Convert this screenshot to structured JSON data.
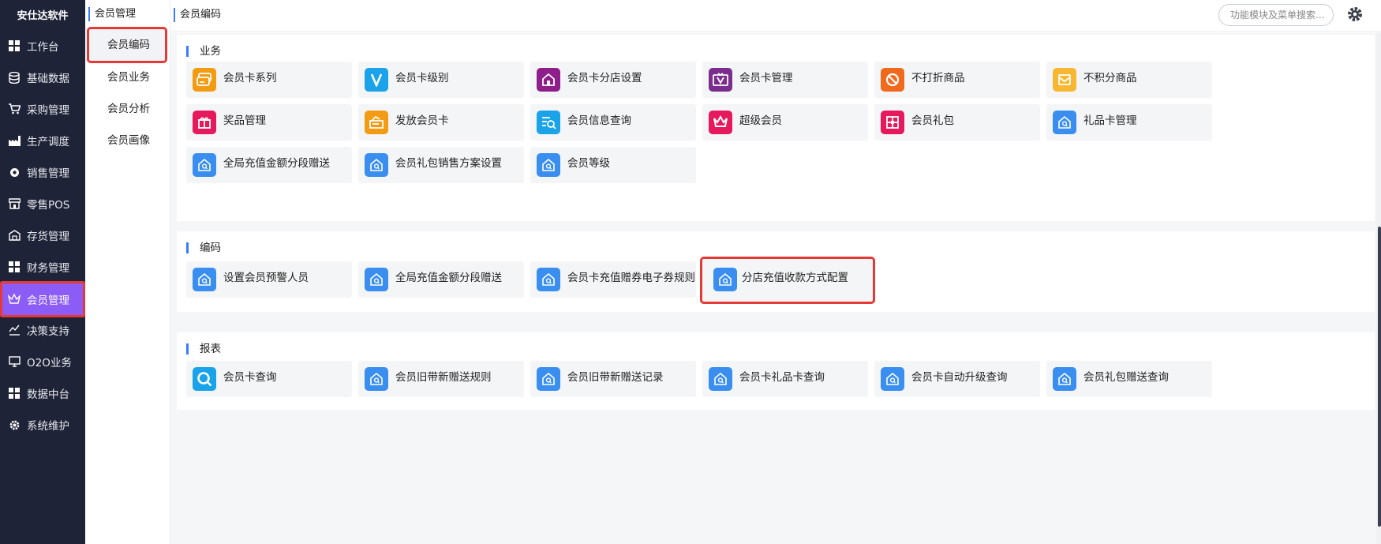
{
  "app": {
    "brand": "安仕达软件"
  },
  "sidebar": {
    "items": [
      {
        "label": "工作台",
        "icon": "grid-icon"
      },
      {
        "label": "基础数据",
        "icon": "database-icon"
      },
      {
        "label": "采购管理",
        "icon": "cart-icon"
      },
      {
        "label": "生产调度",
        "icon": "factory-icon"
      },
      {
        "label": "销售管理",
        "icon": "gear-sales-icon"
      },
      {
        "label": "零售POS",
        "icon": "store-icon"
      },
      {
        "label": "存货管理",
        "icon": "warehouse-icon"
      },
      {
        "label": "财务管理",
        "icon": "grid-icon"
      },
      {
        "label": "会员管理",
        "icon": "crown-icon",
        "active": true
      },
      {
        "label": "决策支持",
        "icon": "chart-icon"
      },
      {
        "label": "O2O业务",
        "icon": "monitor-icon"
      },
      {
        "label": "数据中台",
        "icon": "grid-icon"
      },
      {
        "label": "系统维护",
        "icon": "gear-icon"
      }
    ]
  },
  "submenu": {
    "title": "会员管理",
    "items": [
      "会员编码",
      "会员业务",
      "会员分析",
      "会员画像"
    ],
    "active": "会员编码"
  },
  "topbar": {
    "breadcrumb": "会员编码",
    "search_placeholder": "功能模块及菜单搜索..."
  },
  "sections": {
    "business": {
      "title": "业务",
      "tiles": [
        {
          "label": "会员卡系列",
          "icon": "card-series-icon",
          "color": "#f29b13"
        },
        {
          "label": "会员卡级别",
          "icon": "v-level-icon",
          "color": "#1aa3e8"
        },
        {
          "label": "会员卡分店设置",
          "icon": "store-house-icon",
          "color": "#8e1f8a"
        },
        {
          "label": "会员卡管理",
          "icon": "v-card-icon",
          "color": "#7b2d8e"
        },
        {
          "label": "不打折商品",
          "icon": "no-discount-icon",
          "color": "#f06a1d"
        },
        {
          "label": "不积分商品",
          "icon": "mail-box-icon",
          "color": "#f7b733"
        },
        {
          "label": "奖品管理",
          "icon": "gift-icon",
          "color": "#e6195d"
        },
        {
          "label": "发放会员卡",
          "icon": "issue-card-icon",
          "color": "#f29b13"
        },
        {
          "label": "会员信息查询",
          "icon": "info-search-icon",
          "color": "#1aa3e8"
        },
        {
          "label": "超级会员",
          "icon": "crown-icon",
          "color": "#e6195d"
        },
        {
          "label": "会员礼包",
          "icon": "gift-pack-icon",
          "color": "#e6195d"
        },
        {
          "label": "礼品卡管理",
          "icon": "home-search-icon",
          "color": "#3a8ef0"
        },
        {
          "label": "全局充值金额分段赠送",
          "icon": "home-search-icon",
          "color": "#3a8ef0"
        },
        {
          "label": "会员礼包销售方案设置",
          "icon": "home-search-icon",
          "color": "#3a8ef0"
        },
        {
          "label": "会员等级",
          "icon": "home-search-icon",
          "color": "#3a8ef0"
        }
      ]
    },
    "coding": {
      "title": "编码",
      "tiles": [
        {
          "label": "设置会员预警人员",
          "icon": "home-search-icon",
          "color": "#3a8ef0"
        },
        {
          "label": "全局充值金额分段赠送",
          "icon": "home-search-icon",
          "color": "#3a8ef0"
        },
        {
          "label": "会员卡充值赠券电子券规则",
          "icon": "home-search-icon",
          "color": "#3a8ef0"
        },
        {
          "label": "分店充值收款方式配置",
          "icon": "home-search-icon",
          "color": "#3a8ef0",
          "highlight": true
        }
      ]
    },
    "reports": {
      "title": "报表",
      "tiles": [
        {
          "label": "会员卡查询",
          "icon": "magnifier-icon",
          "color": "#1aa3e8"
        },
        {
          "label": "会员旧带新赠送规则",
          "icon": "home-search-icon",
          "color": "#3a8ef0"
        },
        {
          "label": "会员旧带新赠送记录",
          "icon": "home-search-icon",
          "color": "#3a8ef0"
        },
        {
          "label": "会员卡礼品卡查询",
          "icon": "home-search-icon",
          "color": "#3a8ef0"
        },
        {
          "label": "会员卡自动升级查询",
          "icon": "home-search-icon",
          "color": "#3a8ef0"
        },
        {
          "label": "会员礼包赠送查询",
          "icon": "home-search-icon",
          "color": "#3a8ef0"
        }
      ]
    }
  },
  "colors": {
    "accent": "#3a7afe",
    "sidebar_bg": "#1f2337",
    "active_purple": "#8b5cf6",
    "highlight_red": "#e53935"
  }
}
